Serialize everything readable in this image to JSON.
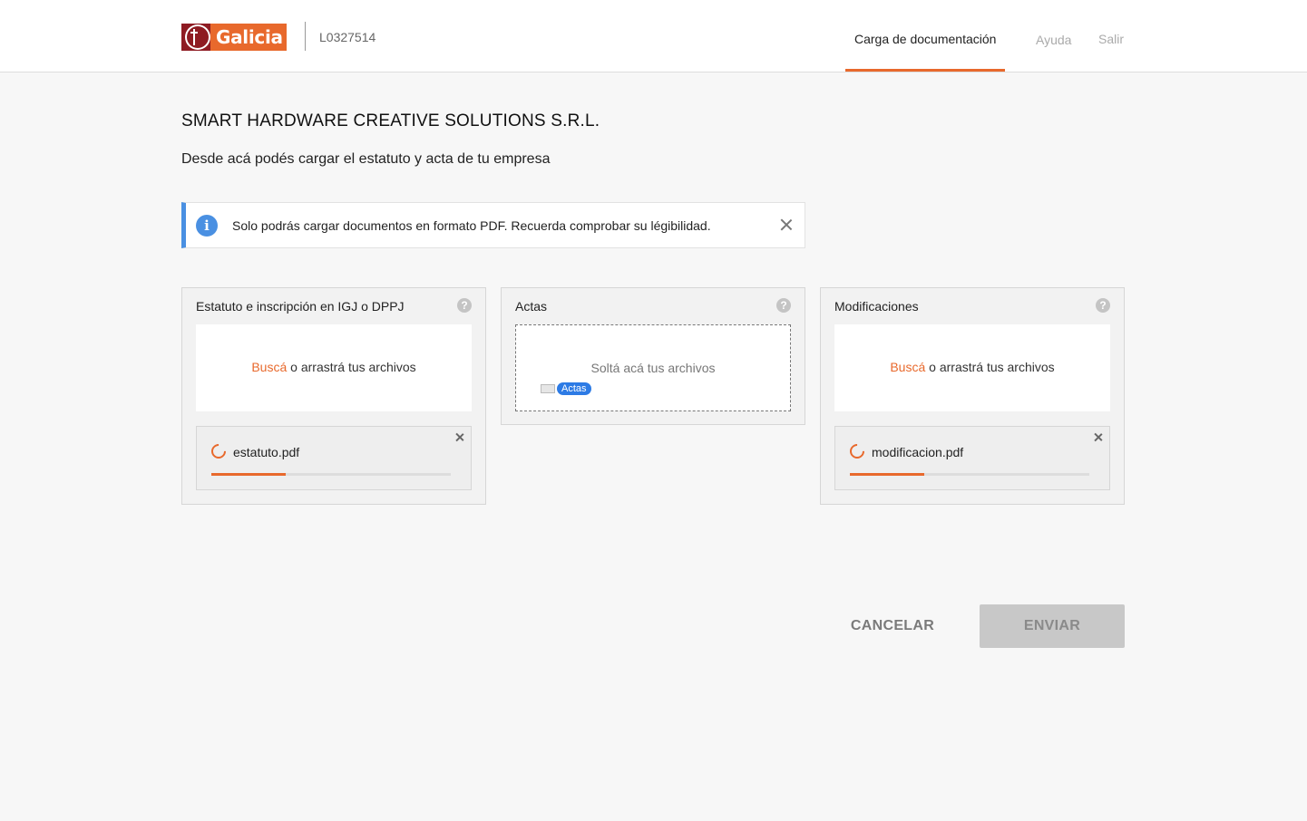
{
  "header": {
    "brand": "Galicia",
    "user_id": "L0327514",
    "nav": {
      "documentation": "Carga de documentación",
      "help": "Ayuda",
      "logout": "Salir"
    }
  },
  "page": {
    "company_name": "SMART HARDWARE CREATIVE SOLUTIONS S.R.L.",
    "subtitle": "Desde acá podés cargar el estatuto y acta de tu empresa"
  },
  "info_banner": {
    "icon": "info-icon",
    "text": "Solo podrás cargar documentos en formato PDF. Recuerda comprobar su légibilidad."
  },
  "cards": [
    {
      "title": "Estatuto e inscripción en IGJ o DPPJ",
      "help": "?",
      "dropzone_link": "Buscá",
      "dropzone_text": " o arrastrá tus archivos",
      "file": {
        "name": "estatuto.pdf",
        "progress": 0.31
      }
    },
    {
      "title": "Actas",
      "help": "?",
      "dropzone_text": "Soltá acá tus archivos",
      "drag_badge": "Actas"
    },
    {
      "title": "Modificaciones",
      "help": "?",
      "dropzone_link": "Buscá",
      "dropzone_text": " o arrastrá tus archivos",
      "file": {
        "name": "modificacion.pdf",
        "progress": 0.31
      }
    }
  ],
  "actions": {
    "cancel": "CANCELAR",
    "send": "ENVIAR"
  },
  "colors": {
    "brand_orange": "#e8692c",
    "brand_red": "#8e1b22",
    "info_blue": "#4a90e2"
  }
}
